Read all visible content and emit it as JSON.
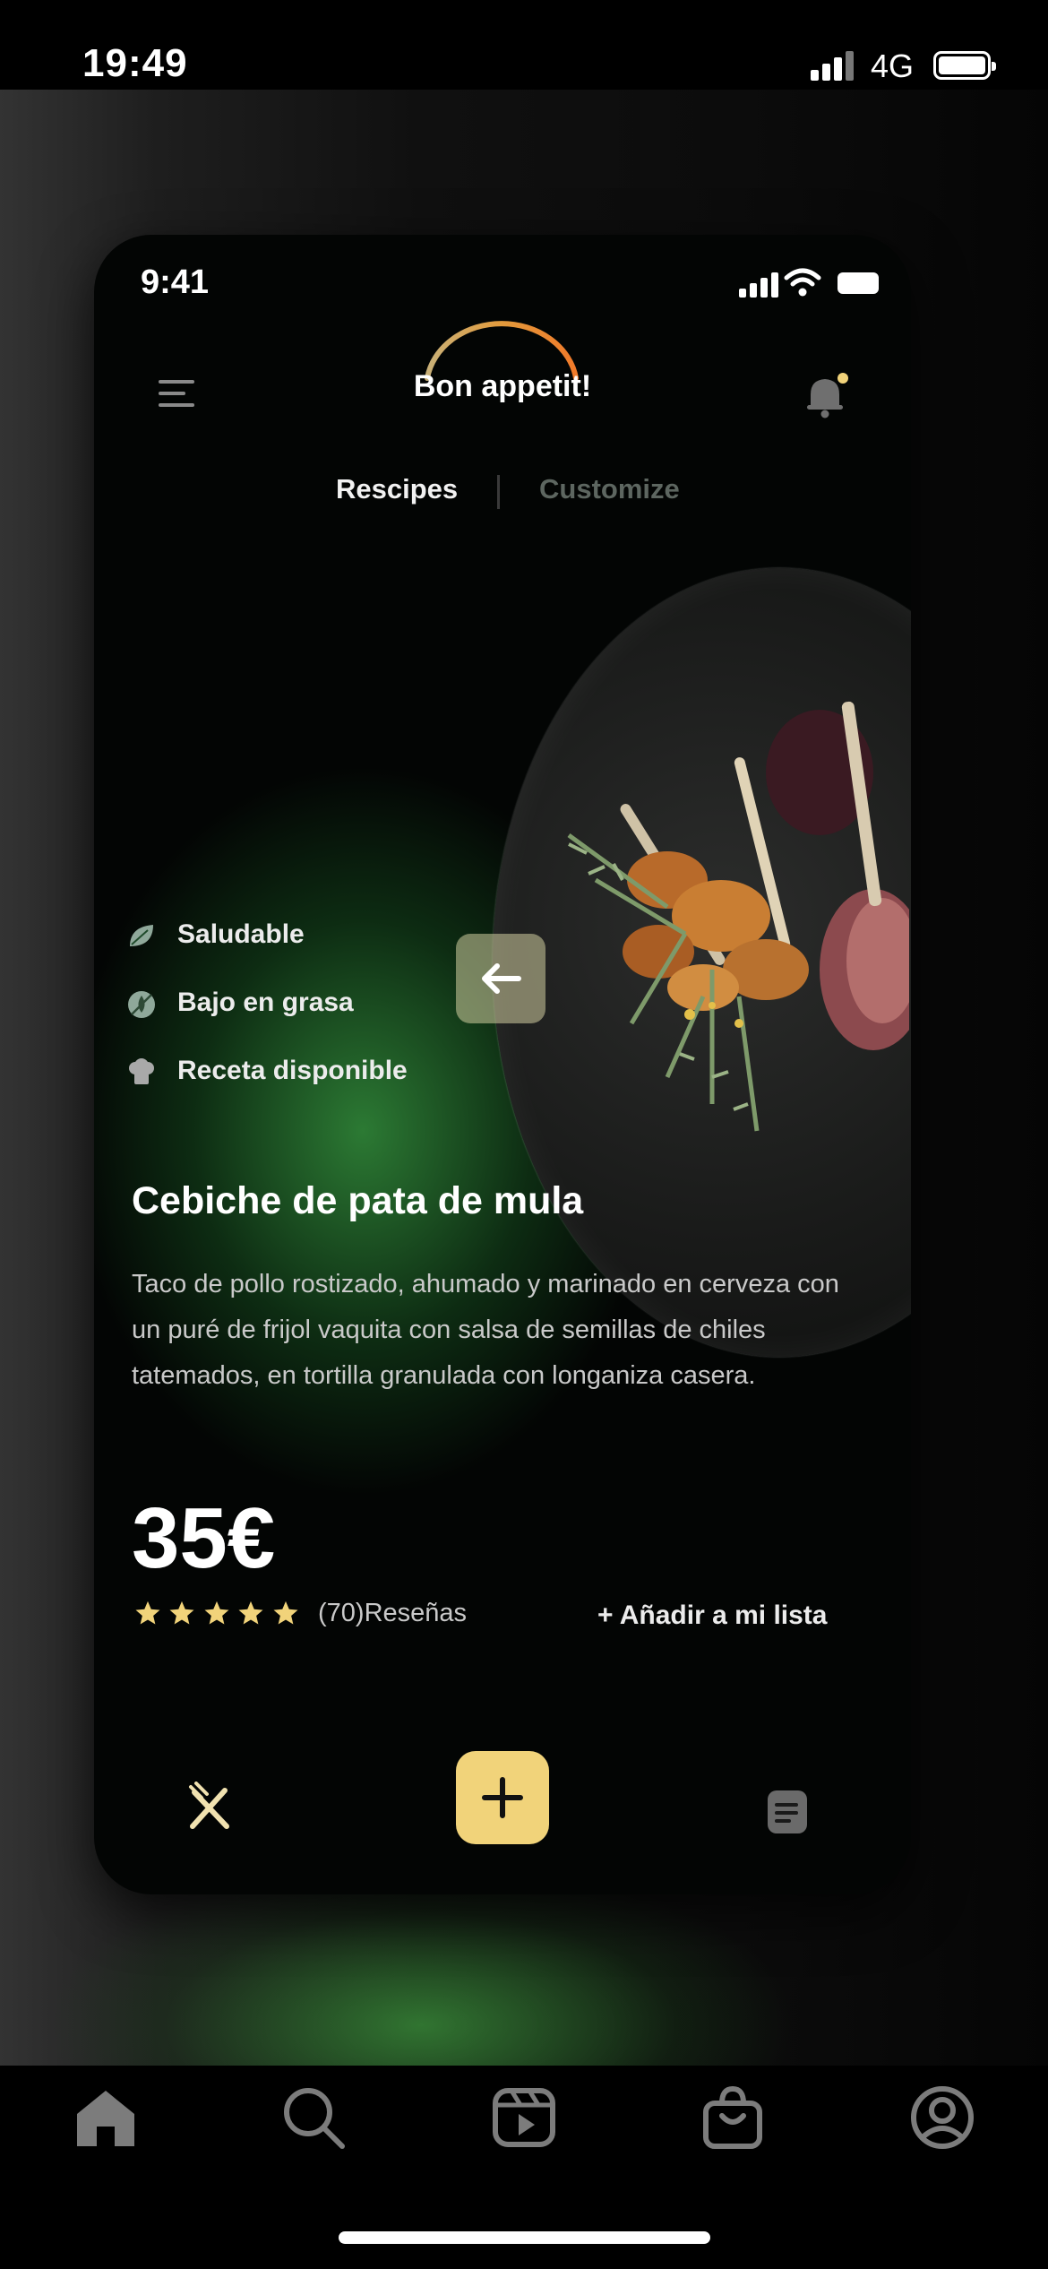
{
  "os_status": {
    "time": "19:49",
    "network": "4G"
  },
  "phone_status": {
    "time": "9:41"
  },
  "header": {
    "brand": "Bon appetit!"
  },
  "tabs": [
    {
      "label": "Rescipes",
      "active": true
    },
    {
      "label": "Customize",
      "active": false
    }
  ],
  "tags": [
    {
      "icon": "leaf-icon",
      "label": "Saludable"
    },
    {
      "icon": "low-fat-icon",
      "label": "Bajo en grasa"
    },
    {
      "icon": "chef-hat-icon",
      "label": "Receta disponible"
    }
  ],
  "dish": {
    "title": "Cebiche de pata de mula",
    "description": "Taco de pollo rostizado, ahumado y marinado en cerveza con un puré de frijol vaquita con salsa de semillas de chiles tatemados, en tortilla granulada con longaniza casera.",
    "price": "35€",
    "rating": 5,
    "reviews": "(70)Reseñas",
    "add_to_list": "+ Añadir a mi lista"
  },
  "bottom_nav": [
    "fork-knife-icon",
    "plus-icon",
    "document-icon"
  ],
  "app_nav": [
    "home-icon",
    "search-icon",
    "reels-icon",
    "shop-icon",
    "profile-icon"
  ],
  "colors": {
    "accent": "#f1d37a",
    "green_glow": "#2e8036",
    "background": "#030504"
  }
}
